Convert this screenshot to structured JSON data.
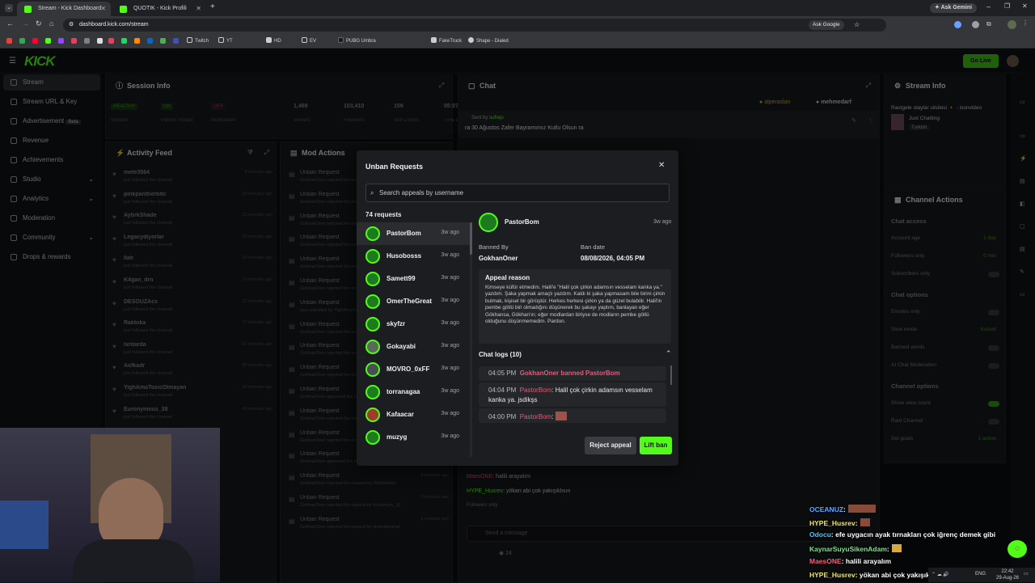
{
  "browser": {
    "tabs": [
      {
        "label": "Stream - Kick Dashboard",
        "active": true
      },
      {
        "label": "QUOTIK - Kick Profili",
        "active": false
      }
    ],
    "ask_gemini": "Ask Gemini",
    "url": "dashboard.kick.com/stream",
    "ask_google": "Ask Google",
    "bookmarks": [
      "Twitch",
      "YT",
      "HD",
      "EV",
      "PUBG Umbra",
      "FakeTruck",
      "Shape - Dialed"
    ]
  },
  "app": {
    "go_live": "Go Live",
    "nav": [
      {
        "label": "Stream",
        "active": true
      },
      {
        "label": "Stream URL & Key"
      },
      {
        "label": "Advertisement",
        "badge": "Beta"
      },
      {
        "label": "Revenue"
      },
      {
        "label": "Achievements"
      },
      {
        "label": "Studio"
      },
      {
        "label": "Analytics"
      },
      {
        "label": "Moderation"
      },
      {
        "label": "Community"
      },
      {
        "label": "Drops & rewards"
      }
    ],
    "session": {
      "title": "Session Info",
      "stats": [
        {
          "value": "HEALTHY",
          "label": "Session"
        },
        {
          "value": "ON",
          "label": "Partner Instant"
        },
        {
          "value": "OFF",
          "label": "Multistream"
        },
        {
          "value": "1,469",
          "label": "Viewers"
        },
        {
          "value": "103,410",
          "label": "Followers"
        },
        {
          "value": "159",
          "label": "Sub Counts"
        },
        {
          "value": "05:07:58",
          "label": "Time Live"
        }
      ]
    },
    "activity": {
      "title": "Activity Feed",
      "items": [
        {
          "name": "mete3564",
          "sub": "just followed the channel",
          "time": "8 minutes ago"
        },
        {
          "name": "pinkpantherbitc",
          "sub": "just followed the channel",
          "time": "10 minutes ago"
        },
        {
          "name": "AybrkShade",
          "sub": "just followed the channel",
          "time": "12 minutes ago"
        },
        {
          "name": "Legacydiyorlar",
          "sub": "just followed the channel",
          "time": "15 minutes ago"
        },
        {
          "name": "Ilah",
          "sub": "just followed the channel",
          "time": "18 minutes ago"
        },
        {
          "name": "K4gan_drn",
          "sub": "just followed the channel",
          "time": "19 minutes ago"
        },
        {
          "name": "DESOUZAcs",
          "sub": "just followed the channel",
          "time": "22 minutes ago"
        },
        {
          "name": "Raktoka",
          "sub": "just followed the channel",
          "time": "27 minutes ago"
        },
        {
          "name": "Ixrdarda",
          "sub": "just followed the channel",
          "time": "31 minutes ago"
        },
        {
          "name": "Asfkadr",
          "sub": "just followed the channel",
          "time": "35 minutes ago"
        },
        {
          "name": "YighAmaToxicOlmayan",
          "sub": "just followed the channel",
          "time": "39 minutes ago"
        },
        {
          "name": "Euronymous_38",
          "sub": "just followed the channel",
          "time": "43 minutes ago"
        }
      ]
    },
    "mod_actions": {
      "title": "Mod Actions",
      "items": [
        {
          "title": "Unban Request",
          "sub": "GokhanOner rejected the request by"
        },
        {
          "title": "Unban Request",
          "sub": "GokhanOner rejected the request by"
        },
        {
          "title": "Unban Request",
          "sub": "GokhanOner rejected the request by"
        },
        {
          "title": "Unban Request",
          "sub": "GokhanOner rejected the request by"
        },
        {
          "title": "Unban Request",
          "sub": "GokhanOner rejected the request by"
        },
        {
          "title": "Unban Request",
          "sub": "GokhanOner rejected the request by"
        },
        {
          "title": "Unban Request",
          "sub": "was subsided by YighAmaToxicOlmayan"
        },
        {
          "title": "Unban Request",
          "sub": "GokhanOner rejected the request by"
        },
        {
          "title": "Unban Request",
          "sub": "GokhanOner rejected the request by"
        },
        {
          "title": "Unban Request",
          "sub": "GokhanOner rejected the request by"
        },
        {
          "title": "Unban Request",
          "sub": "GokhanOner approved the request by"
        },
        {
          "title": "Unban Request",
          "sub": "GokhanOner rejected the request by"
        },
        {
          "title": "Unban Request",
          "sub": "GokhanOner rejected the request by"
        },
        {
          "title": "Unban Request",
          "sub": "GokhanOner approved the request by JWKubsik",
          "time": "5 minutes ago"
        },
        {
          "title": "Unban Request",
          "sub": "GokhanOner rejected the request by 39Hstidatici",
          "time": "5 minutes ago"
        },
        {
          "title": "Unban Request",
          "sub": "GokhanOner rejected the request by Kuzrekum_12",
          "time": "5 minutes ago"
        },
        {
          "title": "Unban Request",
          "sub": "GokhanOner rejected the request by Hamnikogrod",
          "time": "6 minutes ago"
        }
      ]
    },
    "chat": {
      "title": "Chat",
      "pinned_users": [
        "alperaslan",
        "mehmedarf"
      ],
      "pinned_sender": "Sent by",
      "pinned_user": "suftejo",
      "pinned_text": "ra 30 Ağustos Zafer Bayramımız Kutlu Olsun ra",
      "messages": [
        {
          "user": "MaesONE",
          "text": ": halili arayalım"
        },
        {
          "user": "HYPE_Husrev",
          "text": ": yökan abi çok yakışıklısın"
        }
      ],
      "followers_only": "Followers only",
      "input_placeholder": "Send a message",
      "viewer_count": "24"
    },
    "stream_info": {
      "title": "Stream Info",
      "stream_title": "Rastgele olaylar silsilesi 🔸 - isonvideo",
      "category": "Just Chatting",
      "language": "Turkish"
    },
    "channel_actions": {
      "title": "Channel Actions",
      "sections": [
        {
          "heading": "Chat access",
          "rows": [
            {
              "label": "Account age",
              "value": "1 day"
            },
            {
              "label": "Followers only",
              "value": "0 min"
            },
            {
              "label": "Subscribers only",
              "value": ""
            }
          ]
        },
        {
          "heading": "Chat options",
          "rows": [
            {
              "label": "Emotes only",
              "value": ""
            },
            {
              "label": "Slow mode",
              "value": "Instant"
            },
            {
              "label": "Banned words",
              "value": ""
            },
            {
              "label": "AI Chat Moderation",
              "value": ""
            }
          ]
        },
        {
          "heading": "Channel options",
          "rows": [
            {
              "label": "Show view count",
              "value": ""
            },
            {
              "label": "Raid Channel",
              "value": ""
            },
            {
              "label": "Set goals",
              "value": "1 active"
            }
          ]
        }
      ]
    }
  },
  "modal": {
    "title": "Unban Requests",
    "search_placeholder": "Search appeals by username",
    "count_label": "74 requests",
    "requests": [
      {
        "name": "PastorBom",
        "time": "3w ago"
      },
      {
        "name": "Husobosss",
        "time": "3w ago"
      },
      {
        "name": "Samett99",
        "time": "3w ago"
      },
      {
        "name": "OmerTheGreat",
        "time": "3w ago"
      },
      {
        "name": "skyfzr",
        "time": "3w ago"
      },
      {
        "name": "Gokayabi",
        "time": "3w ago"
      },
      {
        "name": "MOVRO_0xFF",
        "time": "3w ago"
      },
      {
        "name": "torranagaa",
        "time": "3w ago"
      },
      {
        "name": "Kafaacar",
        "time": "3w ago"
      },
      {
        "name": "muzyg",
        "time": "3w ago"
      }
    ],
    "detail": {
      "user": "PastorBom",
      "time": "3w ago",
      "banned_by_label": "Banned By",
      "banned_by": "GokhanOner",
      "ban_date_label": "Ban date",
      "ban_date": "08/08/2026, 04:05 PM",
      "appeal_label": "Appeal reason",
      "appeal_text": "Kimseye küfür etmedim. Halil'e \"Halil çok çirkin adamsın vesselam kanka ya.\" yazdım. Şaka yapmak amaçlı yazdım. Kaldı ki şaka yapmasam bile birini çirkin bulmak, kişisel bir görüştür. Herkes herkesi çirkin ya da güzel bulabilir. Halil'in pembe götlü biri olmadığını düşünerek bu şakayı yaptım, banlayan eğer Gökhansa, Gökhan'ın; eğer modlardan biriyse de modların pembe götlü olduğunu düşünmemedim. Pardon.",
      "logs_label": "Chat logs (10)",
      "logs": [
        {
          "time": "04:05 PM",
          "text": "GokhanOner banned PastorBom"
        },
        {
          "time": "04:04 PM",
          "user": "PastorBom",
          "text": ": Halil çok çirkin adamsın vesselam kanka ya. jsdikşs"
        },
        {
          "time": "04:00 PM",
          "user": "PastorBom",
          "text": ":"
        }
      ]
    },
    "reject_label": "Reject appeal",
    "lift_label": "Lift ban"
  },
  "overlay_chat": [
    {
      "user": "OCEANUZ",
      "text": ":",
      "color": "#5fa8ff"
    },
    {
      "user": "HYPE_Husrev",
      "text": ":",
      "color": "#f5e663"
    },
    {
      "user": "Odocu",
      "text": ": efe uygacın ayak tırnakları çok iğrenç demek gibi",
      "color": "#4fc3f7"
    },
    {
      "user": "KaynarSuyuSikenAdam",
      "text": ":",
      "color": "#7ee08a"
    },
    {
      "user": "MaesONE",
      "text": ": halili arayalım",
      "color": "#ff5c7a"
    },
    {
      "user": "HYPE_Husrev",
      "text": ": yökan abi çok yakışıklısın",
      "color": "#f5e663"
    }
  ],
  "taskbar": {
    "lang": "ENG",
    "time": "22:42",
    "date": "29-Aug-26"
  },
  "colors": {
    "kick_green": "#53fc18",
    "danger": "#e85a7a",
    "panel": "#17181b"
  }
}
